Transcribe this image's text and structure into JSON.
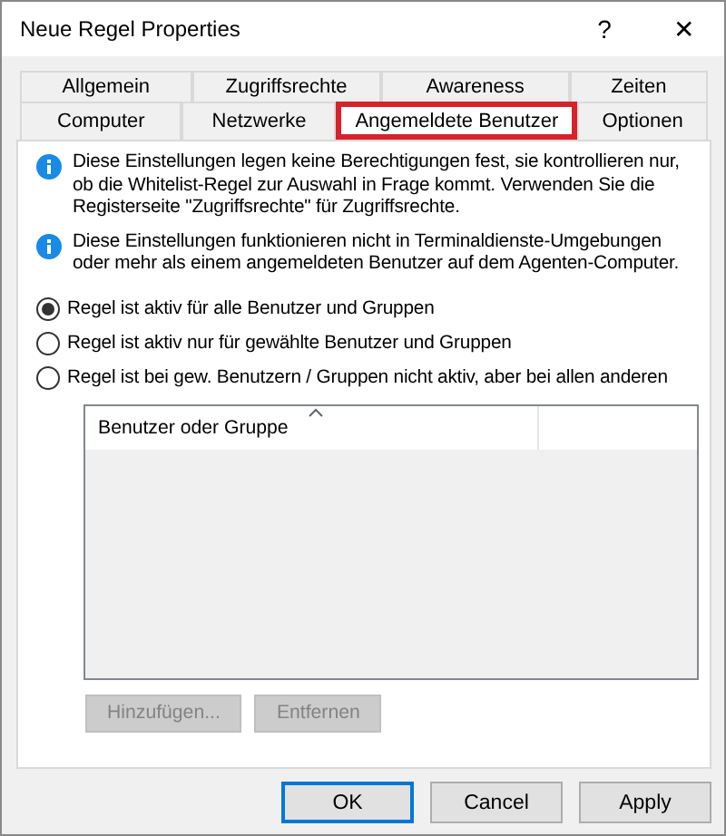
{
  "window": {
    "title": "Neue Regel Properties",
    "help": "?",
    "close": "✕"
  },
  "tab_rows": [
    [
      {
        "label": "Allgemein",
        "selected": false
      },
      {
        "label": "Zugriffsrechte",
        "selected": false
      },
      {
        "label": "Awareness",
        "selected": false
      },
      {
        "label": "Zeiten",
        "selected": false
      }
    ],
    [
      {
        "label": "Computer",
        "selected": false
      },
      {
        "label": "Netzwerke",
        "selected": false
      },
      {
        "label": "Angemeldete Benutzer",
        "selected": true
      },
      {
        "label": "Optionen",
        "selected": false
      }
    ]
  ],
  "notes": [
    "Diese Einstellungen legen keine Berechtigungen fest, sie kontrollieren nur, ob die Whitelist-Regel zur Auswahl in Frage kommt. Verwenden Sie die Registerseite \"Zugriffsrechte\" für Zugriffsrechte.",
    "Diese Einstellungen funktionieren nicht in Terminaldienste-Umgebungen oder mehr als einem angemeldeten Benutzer auf dem Agenten-Computer."
  ],
  "options": [
    {
      "label": "Regel ist aktiv für alle Benutzer und Gruppen",
      "selected": true
    },
    {
      "label": "Regel ist aktiv nur für gewählte Benutzer und Gruppen",
      "selected": false
    },
    {
      "label": "Regel ist bei gew. Benutzern / Gruppen nicht aktiv, aber bei allen anderen",
      "selected": false
    }
  ],
  "table": {
    "columns": [
      "Benutzer oder Gruppe"
    ]
  },
  "list_buttons": [
    {
      "label": "Hinzufügen...",
      "disabled": true
    },
    {
      "label": "Entfernen",
      "disabled": true
    }
  ],
  "buttons": [
    {
      "label": "OK",
      "default": true
    },
    {
      "label": "Cancel",
      "default": false
    },
    {
      "label": "Apply",
      "default": false
    }
  ]
}
